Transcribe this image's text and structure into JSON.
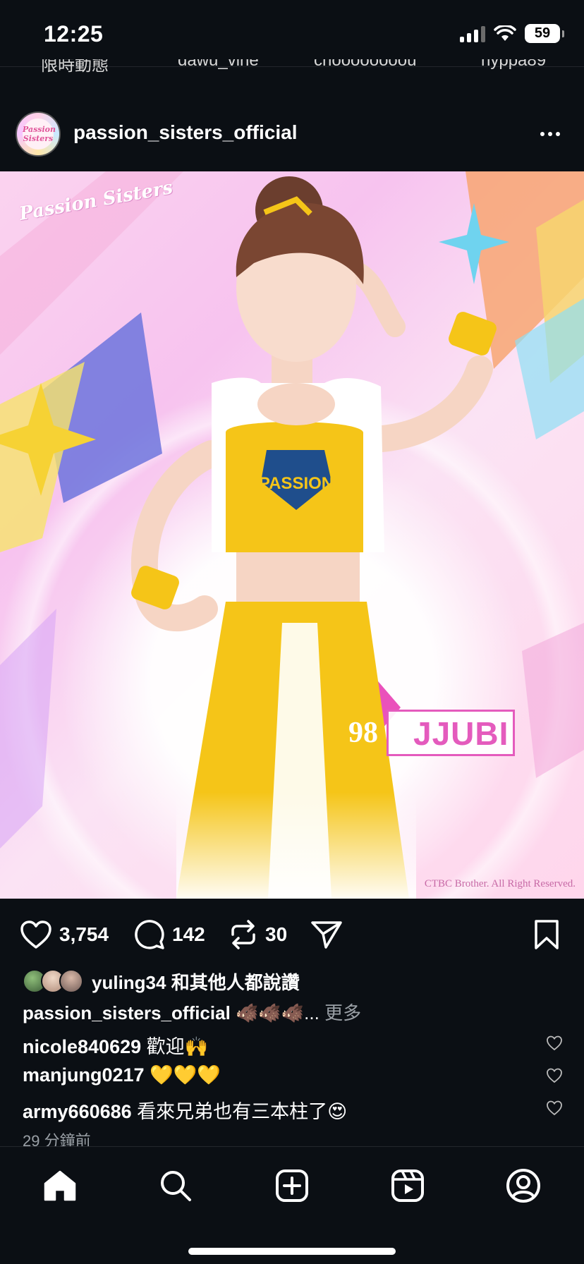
{
  "status_bar": {
    "time": "12:25",
    "battery": "59"
  },
  "stories": [
    {
      "label": "限時動態"
    },
    {
      "label": "dawu_vine"
    },
    {
      "label": "choooooooou"
    },
    {
      "label": "hyppa89"
    }
  ],
  "post": {
    "username": "passion_sisters_official",
    "avatar_text": "Passion Sisters",
    "image": {
      "logo_text": "Passion Sisters",
      "uniform_text": "PASSION SISTERS",
      "player_number": "98",
      "player_name": "JJUBI",
      "copyright": "CTBC Brother. All Right Reserved."
    },
    "likes": "3,754",
    "comments_count": "142",
    "reposts": "30",
    "liked_by": "yuling34 和其他人都說讚",
    "caption_user": "passion_sisters_official",
    "caption_text": "🐗🐗🐗...",
    "caption_more": "更多",
    "comments": [
      {
        "user": "nicole840629",
        "text": "歡迎🙌"
      },
      {
        "user": "manjung0217",
        "text": "💛💛💛"
      },
      {
        "user": "army660686",
        "text": "看來兄弟也有三本柱了😍"
      }
    ],
    "time_ago": "29 分鐘前"
  },
  "colors": {
    "background": "#0b0f14",
    "accent_pink": "#e45bbd",
    "uniform_yellow": "#f5c518",
    "muted_text": "#9aa0a6"
  },
  "icons": [
    "heart-icon",
    "comment-icon",
    "repost-icon",
    "share-icon",
    "bookmark-icon",
    "home-icon",
    "search-icon",
    "create-icon",
    "reels-icon",
    "profile-icon"
  ]
}
